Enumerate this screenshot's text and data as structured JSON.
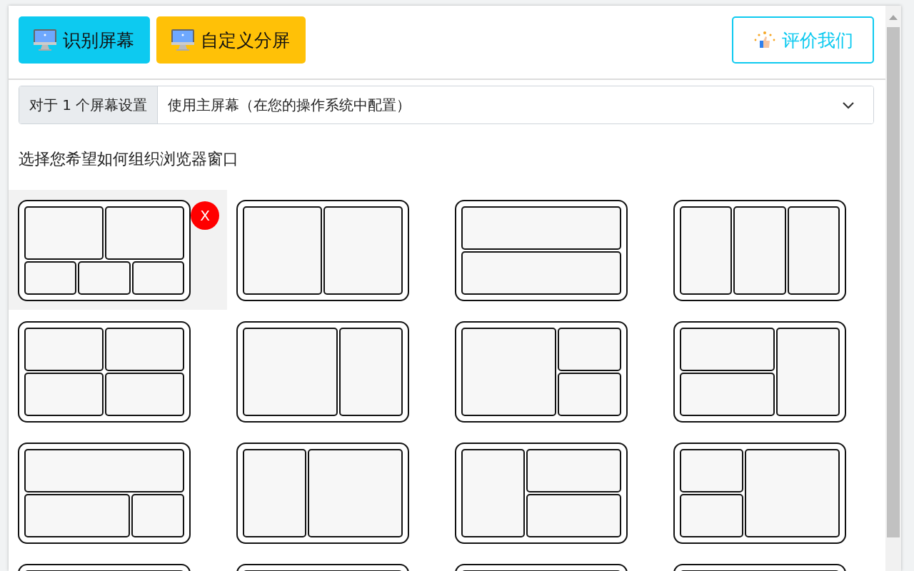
{
  "toolbar": {
    "buttons": [
      {
        "label": "识别屏幕",
        "kind": "info"
      },
      {
        "label": "自定义分屏",
        "kind": "warning"
      }
    ],
    "rate_button": {
      "label": "评价我们"
    }
  },
  "screen_select": {
    "prefix": "对于 1 个屏幕设置",
    "value": "使用主屏幕（在您的操作系统中配置）"
  },
  "instruction": "选择您希望如何组织浏览器窗口",
  "remove_mark": "X",
  "layouts": [
    {
      "kind": "two-over-three",
      "selected": true
    },
    {
      "kind": "two-columns",
      "selected": false
    },
    {
      "kind": "two-rows",
      "selected": false
    },
    {
      "kind": "three-columns",
      "selected": false
    },
    {
      "kind": "grid-2x2",
      "selected": false
    },
    {
      "kind": "wide-left-column",
      "selected": false
    },
    {
      "kind": "left-big-right-stacked",
      "selected": false
    },
    {
      "kind": "left-stacked-right-big",
      "selected": false
    },
    {
      "kind": "top-over-wide-narrow",
      "selected": false
    },
    {
      "kind": "wide-right-column",
      "selected": false
    },
    {
      "kind": "narrow-left-right-stacked",
      "selected": false
    },
    {
      "kind": "narrow-left-stacked-right-big",
      "selected": false
    },
    {
      "kind": "cut-off",
      "selected": false
    },
    {
      "kind": "cut-off",
      "selected": false
    },
    {
      "kind": "cut-off",
      "selected": false
    },
    {
      "kind": "cut-off",
      "selected": false
    }
  ]
}
